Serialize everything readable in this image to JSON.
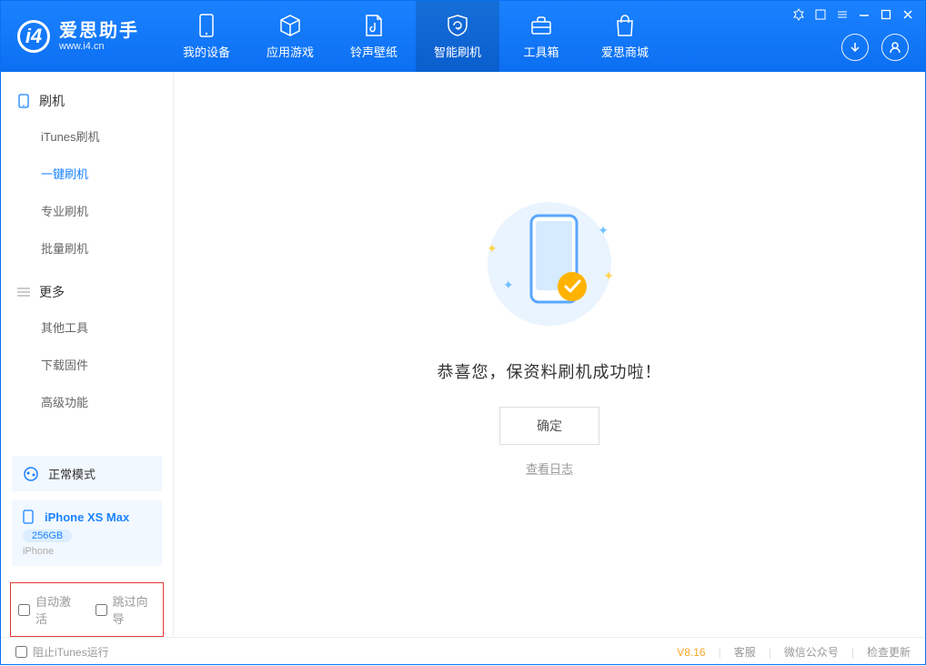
{
  "app": {
    "name_cn": "爱思助手",
    "name_en": "www.i4.cn"
  },
  "nav": {
    "items": [
      {
        "label": "我的设备"
      },
      {
        "label": "应用游戏"
      },
      {
        "label": "铃声壁纸"
      },
      {
        "label": "智能刷机"
      },
      {
        "label": "工具箱"
      },
      {
        "label": "爱思商城"
      }
    ]
  },
  "sidebar": {
    "sections": [
      {
        "title": "刷机",
        "items": [
          "iTunes刷机",
          "一键刷机",
          "专业刷机",
          "批量刷机"
        ]
      },
      {
        "title": "更多",
        "items": [
          "其他工具",
          "下载固件",
          "高级功能"
        ]
      }
    ],
    "mode": "正常模式",
    "device": {
      "name": "iPhone XS Max",
      "storage": "256GB",
      "type": "iPhone"
    },
    "options": {
      "auto_activate": "自动激活",
      "skip_guide": "跳过向导"
    }
  },
  "main": {
    "success_text": "恭喜您，保资料刷机成功啦！",
    "ok_button": "确定",
    "view_log": "查看日志"
  },
  "footer": {
    "block_itunes": "阻止iTunes运行",
    "version": "V8.16",
    "links": [
      "客服",
      "微信公众号",
      "检查更新"
    ]
  }
}
